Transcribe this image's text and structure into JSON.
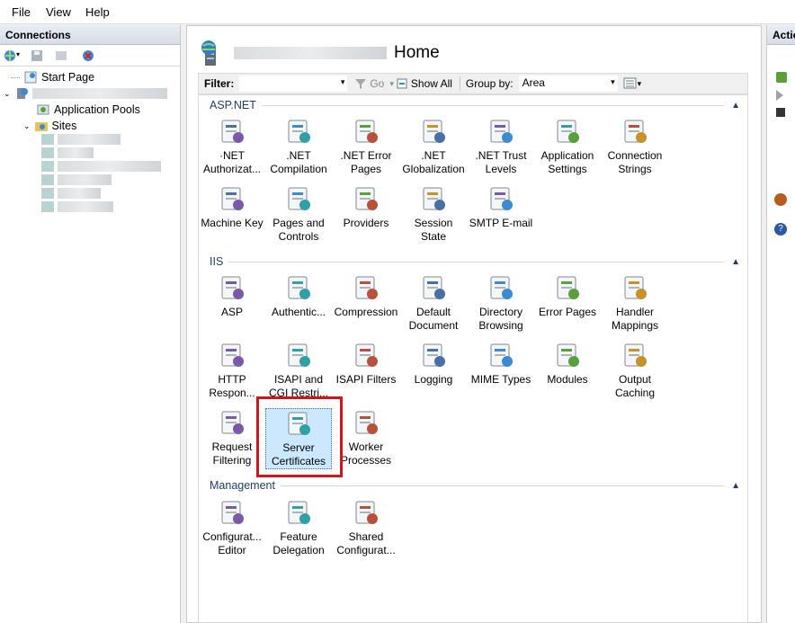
{
  "menu": {
    "file": "File",
    "view": "View",
    "help": "Help"
  },
  "connections": {
    "title": "Connections",
    "start_page": "Start Page",
    "app_pools": "Application Pools",
    "sites": "Sites"
  },
  "main": {
    "title": "Home",
    "filter_label": "Filter:",
    "go_label": "Go",
    "show_all_label": "Show All",
    "group_by_label": "Group by:",
    "group_by_value": "Area"
  },
  "groups": {
    "aspnet": "ASP.NET",
    "iis": "IIS",
    "management": "Management"
  },
  "tiles": {
    "aspnet": [
      "·NET\nAuthorizat...",
      ".NET\nCompilation",
      ".NET Error\nPages",
      ".NET\nGlobalization",
      ".NET Trust\nLevels",
      "Application\nSettings",
      "Connection\nStrings",
      "Machine Key",
      "Pages and\nControls",
      "Providers",
      "Session State",
      "SMTP E-mail"
    ],
    "iis": [
      "ASP",
      "Authentic...",
      "Compression",
      "Default\nDocument",
      "Directory\nBrowsing",
      "Error Pages",
      "Handler\nMappings",
      "HTTP\nRespon...",
      "ISAPI and\nCGI Restri...",
      "ISAPI Filters",
      "Logging",
      "MIME Types",
      "Modules",
      "Output\nCaching",
      "Request\nFiltering",
      "Server\nCertificates",
      "Worker\nProcesses"
    ],
    "management": [
      "Configurat...\nEditor",
      "Feature\nDelegation",
      "Shared\nConfigurat..."
    ]
  },
  "actions": {
    "title": "Actions"
  }
}
